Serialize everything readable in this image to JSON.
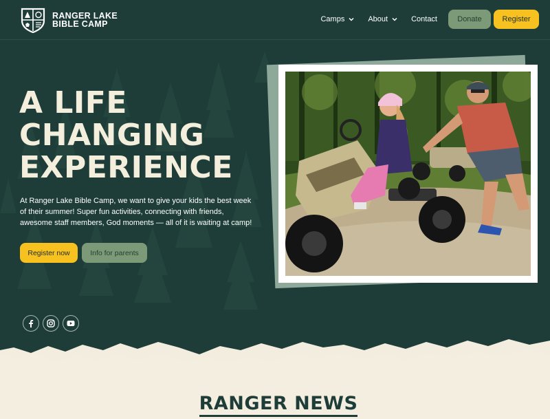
{
  "brand": {
    "line1": "RANGER LAKE",
    "line2": "BIBLE CAMP",
    "logo_icon": "shield-crest-icon"
  },
  "nav": {
    "items": [
      {
        "label": "Camps",
        "has_dropdown": true
      },
      {
        "label": "About",
        "has_dropdown": true
      },
      {
        "label": "Contact",
        "has_dropdown": false
      }
    ],
    "donate_label": "Donate",
    "register_label": "Register"
  },
  "hero": {
    "headline": [
      "A LIFE",
      "CHANGING",
      "EXPERIENCE"
    ],
    "intro": "At Ranger Lake Bible Camp, we want to give your kids the best week of their summer! Super fun activities, connecting with friends, awesome staff members, God moments — all of it is waiting at camp!",
    "cta_primary": "Register now",
    "cta_secondary": "Info for parents",
    "photo_alt": "Kids riding pedal go-karts"
  },
  "social": [
    {
      "name": "facebook-icon",
      "glyph": "f"
    },
    {
      "name": "instagram-icon",
      "glyph": ""
    },
    {
      "name": "youtube-icon",
      "glyph": ""
    }
  ],
  "news": {
    "title": "RANGER NEWS"
  },
  "colors": {
    "bg_dark": "#1e3d39",
    "accent_yellow": "#f7c11f",
    "accent_sage": "#7d9a78",
    "cream": "#f4eedc"
  }
}
